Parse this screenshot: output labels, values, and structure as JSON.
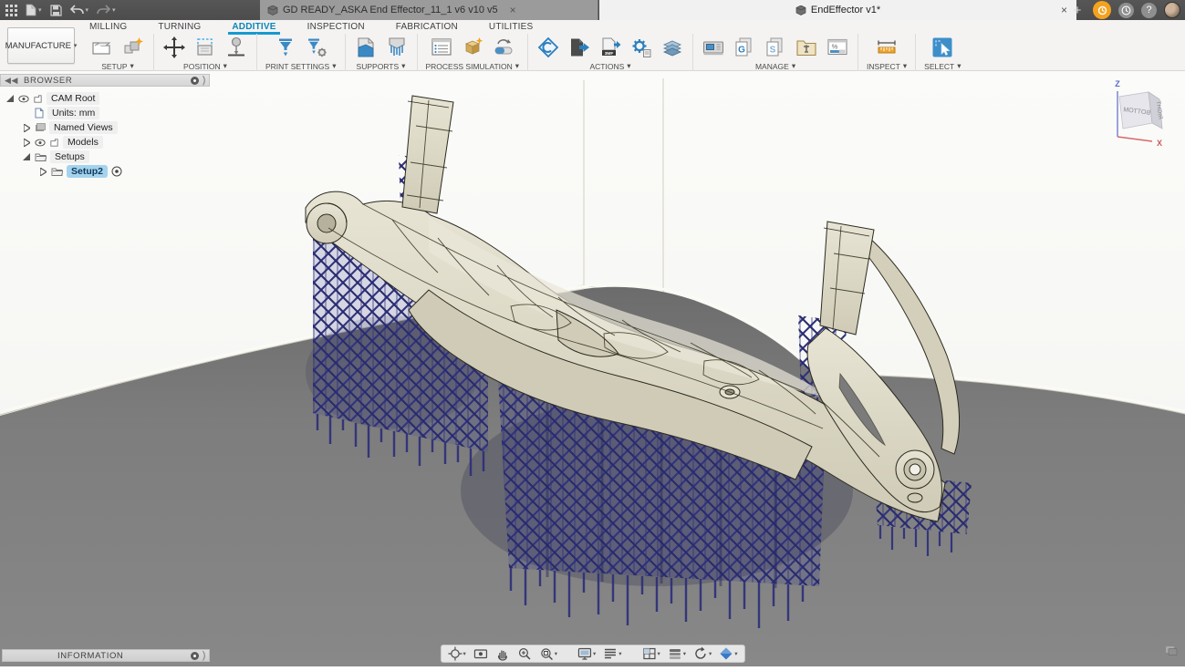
{
  "titlebar": {
    "doc_tabs": [
      {
        "title": "GD READY_ASKA End Effector_11_1 v6 v10 v5",
        "active": false
      },
      {
        "title": "EndEffector v1*",
        "active": true
      }
    ],
    "new_tab_glyph": "+",
    "help_glyph": "?"
  },
  "workspace_button": {
    "label": "MANUFACTURE"
  },
  "ribbon": {
    "tabs": [
      {
        "label": "MILLING",
        "active": false
      },
      {
        "label": "TURNING",
        "active": false
      },
      {
        "label": "ADDITIVE",
        "active": true
      },
      {
        "label": "INSPECTION",
        "active": false
      },
      {
        "label": "FABRICATION",
        "active": false
      },
      {
        "label": "UTILITIES",
        "active": false
      }
    ],
    "groups": [
      {
        "label": "SETUP"
      },
      {
        "label": "POSITION"
      },
      {
        "label": "PRINT SETTINGS"
      },
      {
        "label": "SUPPORTS"
      },
      {
        "label": "PROCESS SIMULATION"
      },
      {
        "label": "ACTIONS"
      },
      {
        "label": "MANAGE"
      },
      {
        "label": "INSPECT"
      },
      {
        "label": "SELECT"
      }
    ],
    "icon_badges": {
      "threemf": "3MF",
      "g": "G",
      "s": "S",
      "percent": "%"
    }
  },
  "browser": {
    "header": "BROWSER",
    "items": [
      {
        "label": "CAM Root"
      },
      {
        "label": "Units: mm"
      },
      {
        "label": "Named Views"
      },
      {
        "label": "Models"
      },
      {
        "label": "Setups"
      },
      {
        "label": "Setup2",
        "selected": true
      }
    ]
  },
  "viewcube": {
    "axis_z": "Z",
    "axis_x": "X",
    "face_bottom": "BOTTOM",
    "face_right": "RIGHT"
  },
  "information_panel": {
    "header": "INFORMATION"
  },
  "nav_toolbar_icons": [
    "orbit",
    "look-at",
    "pan",
    "zoom",
    "fit",
    "display-settings",
    "grid-and-snaps",
    "viewports",
    "layers",
    "refresh",
    "visual-style"
  ],
  "scene": {
    "description": "Generative-design end effector part with blue lattice support structures on additive build plate, viewed from below",
    "model_color": "#d9d5c1",
    "support_color": "#2f3183",
    "plate_color": "#7e7e7e"
  },
  "colors": {
    "accent": "#1799d1",
    "active_tab_text": "#0b87b7",
    "orange_badge": "#f5a21e"
  }
}
